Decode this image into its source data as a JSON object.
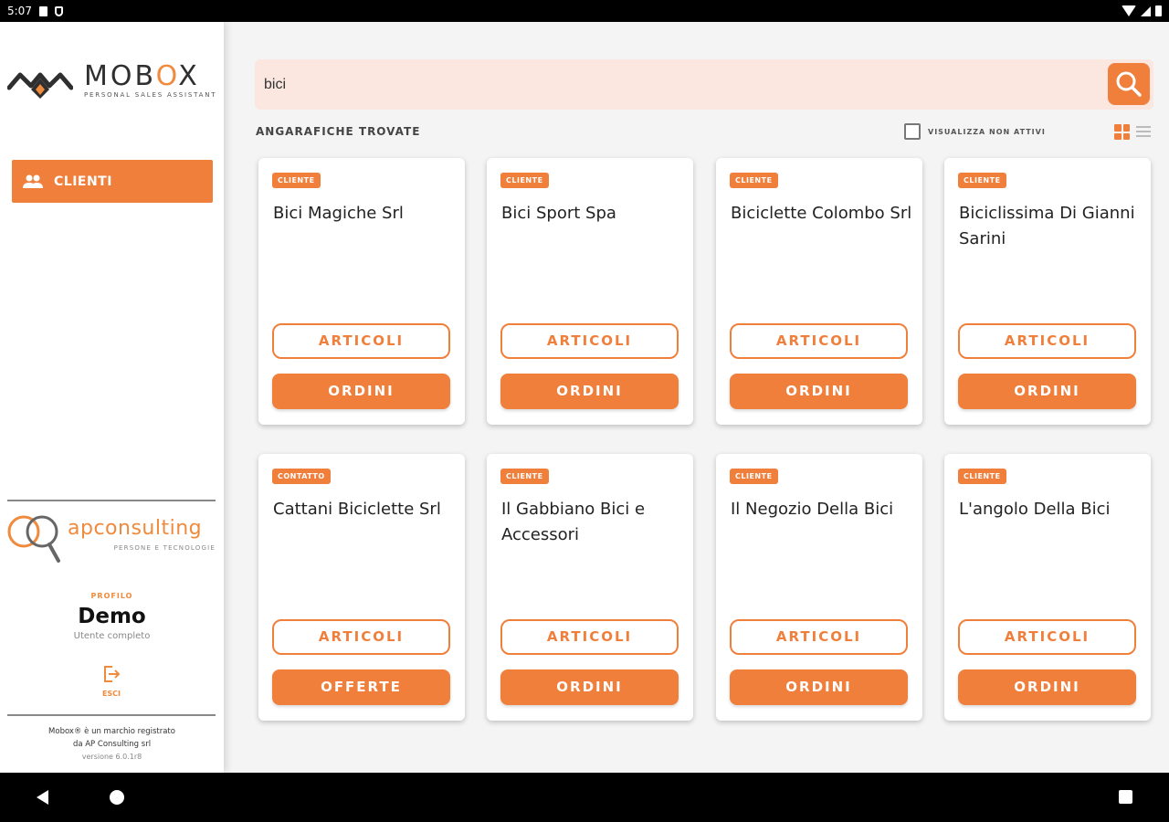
{
  "status_bar": {
    "time": "5:07"
  },
  "sidebar": {
    "logo_word_before": "MOB",
    "logo_word_accent": "O",
    "logo_word_after": "X",
    "logo_tagline": "PERSONAL SALES ASSISTANT",
    "nav_items": [
      {
        "label": "CLIENTI",
        "icon": "people-icon"
      }
    ],
    "company_name": "apconsulting",
    "company_tagline": "PERSONE E TECNOLOGIE",
    "profile_label": "PROFILO",
    "profile_name": "Demo",
    "profile_role": "Utente completo",
    "logout_label": "ESCI",
    "footer_line1": "Mobox® è un marchio registrato",
    "footer_line2": "da AP Consulting srl",
    "version": "versione 6.0.1r8"
  },
  "search": {
    "value": "bici"
  },
  "results": {
    "title": "ANGARAFICHE TROVATE",
    "toggle_label": "VISUALIZZA NON ATTIVI",
    "toggle_checked": false,
    "view_mode": "grid"
  },
  "colors": {
    "accent": "#f07f3c",
    "search_bg": "#fbe6e0"
  },
  "cards": [
    {
      "badge": "CLIENTE",
      "name": "Bici Magiche Srl",
      "secondary": "ARTICOLI",
      "primary": "ORDINI"
    },
    {
      "badge": "CLIENTE",
      "name": "Bici Sport Spa",
      "secondary": "ARTICOLI",
      "primary": "ORDINI"
    },
    {
      "badge": "CLIENTE",
      "name": "Biciclette Colombo Srl",
      "secondary": "ARTICOLI",
      "primary": "ORDINI"
    },
    {
      "badge": "CLIENTE",
      "name": "Biciclissima Di Gianni Sarini",
      "secondary": "ARTICOLI",
      "primary": "ORDINI"
    },
    {
      "badge": "CONTATTO",
      "name": "Cattani Biciclette Srl",
      "secondary": "ARTICOLI",
      "primary": "OFFERTE"
    },
    {
      "badge": "CLIENTE",
      "name": "Il Gabbiano Bici e Accessori",
      "secondary": "ARTICOLI",
      "primary": "ORDINI"
    },
    {
      "badge": "CLIENTE",
      "name": "Il Negozio Della Bici",
      "secondary": "ARTICOLI",
      "primary": "ORDINI"
    },
    {
      "badge": "CLIENTE",
      "name": "L'angolo Della Bici",
      "secondary": "ARTICOLI",
      "primary": "ORDINI"
    }
  ]
}
